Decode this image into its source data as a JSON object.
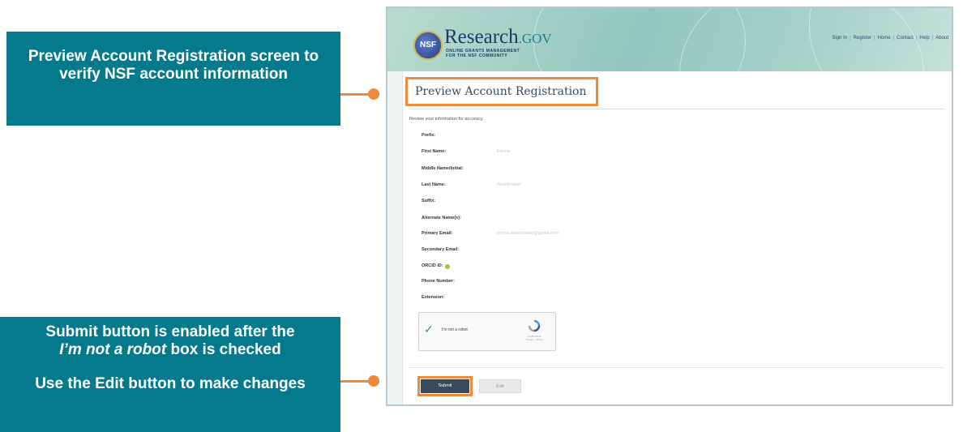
{
  "callouts": {
    "preview": "Preview Account Registration screen to verify NSF account information",
    "submit_pre": "Submit button is enabled after the",
    "submit_italic": "I’m not a robot",
    "submit_post": " box is checked",
    "edit": "Use the Edit button to make changes"
  },
  "header": {
    "logo_seal": "NSF",
    "logo_name": "Research",
    "logo_tld": ".GOV",
    "tagline_line1": "ONLINE GRANTS MANAGEMENT",
    "tagline_line2": "FOR THE NSF COMMUNITY",
    "nav": [
      "Sign In",
      "Register",
      "Home",
      "Contact",
      "Help",
      "About"
    ]
  },
  "page": {
    "title": "Preview Account Registration",
    "intro": "Review your information for accuracy.",
    "fields": [
      {
        "label": "Prefix:",
        "value": ""
      },
      {
        "label": "First Name:",
        "value": "Emma"
      },
      {
        "label": "Middle Name/Initial:",
        "value": ""
      },
      {
        "label": "Last Name:",
        "value": "Woodmaker"
      },
      {
        "label": "Suffix:",
        "value": ""
      },
      {
        "label": "Alternate Name(s):",
        "value": ""
      },
      {
        "label": "Primary Email:",
        "value": "emma.woodmaker@gmail.com"
      },
      {
        "label": "Secondary Email:",
        "value": ""
      },
      {
        "label": "ORCID iD:",
        "value": ""
      },
      {
        "label": "Phone Number:",
        "value": ""
      },
      {
        "label": "Extension:",
        "value": ""
      }
    ]
  },
  "captcha": {
    "label": "I'm not a robot",
    "brand": "reCAPTCHA",
    "links": "Privacy - Terms",
    "checked": true
  },
  "buttons": {
    "submit": "Submit",
    "edit": "Edit"
  },
  "colors": {
    "callout_bg": "#057a8d",
    "highlight": "#ef8a3c",
    "submit_bg": "#3b4a5b"
  }
}
